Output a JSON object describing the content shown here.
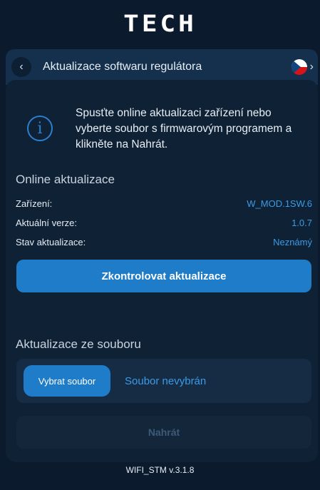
{
  "brand": {
    "logo_text": "TECH"
  },
  "header": {
    "title": "Aktualizace softwaru regulátora",
    "back_icon": "chevron-left-icon",
    "language_flag": "czech-flag-icon",
    "language_chevron": "chevron-right-icon"
  },
  "info": {
    "icon": "info-icon",
    "text": "Spusťte online aktualizaci zařízení nebo vyberte soubor s firmwarovým programem a klikněte na Nahrát."
  },
  "online": {
    "title": "Online aktualizace",
    "rows": [
      {
        "label": "Zařízení:",
        "value": "W_MOD.1SW.6"
      },
      {
        "label": "Aktuální verze:",
        "value": "1.0.7"
      },
      {
        "label": "Stav aktualizace:",
        "value": "Neznámý"
      }
    ],
    "check_button": "Zkontrolovat aktualizace"
  },
  "file": {
    "title": "Aktualizace ze souboru",
    "select_button": "Vybrat soubor",
    "status": "Soubor nevybrán",
    "upload_button": "Nahrát"
  },
  "footer": {
    "version": "WIFI_STM v.3.1.8"
  },
  "colors": {
    "background": "#0b1a2c",
    "card": "#0f2135",
    "accent": "#1f7cc8",
    "link": "#3a9be6"
  }
}
